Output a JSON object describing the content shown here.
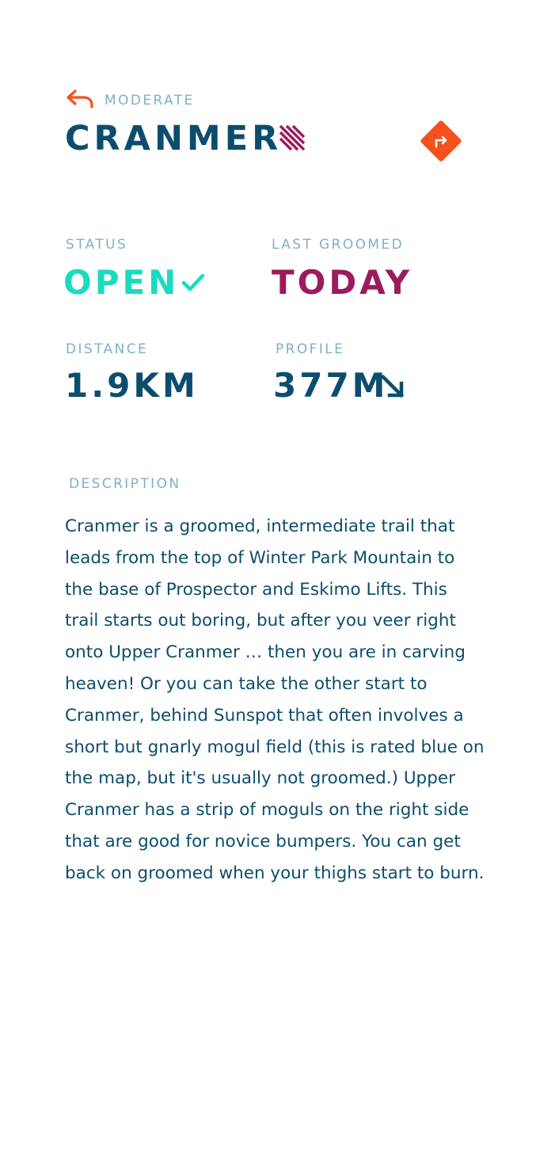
{
  "header": {
    "back_icon": "curved-back-arrow-icon",
    "difficulty": "MODERATE",
    "title": "CRANMER",
    "difficulty_icon": "diagonal-stripes-icon",
    "directions_icon": "turn-right-diamond-icon"
  },
  "stats": {
    "status": {
      "label": "STATUS",
      "value": "OPEN",
      "icon": "checkmark-icon"
    },
    "last_groomed": {
      "label": "LAST GROOMED",
      "value": "TODAY"
    },
    "distance": {
      "label": "DISTANCE",
      "value": "1.9KM"
    },
    "profile": {
      "label": "PROFILE",
      "value": "377M",
      "icon": "arrow-down-right-icon"
    }
  },
  "description": {
    "label": "DESCRIPTION",
    "text": "Cranmer is a groomed, intermediate trail that leads from the top of Winter Park Mountain to the base of Prospector and Eskimo Lifts. This trail starts out boring, but after you veer right onto Upper Cranmer … then you are in carving heaven! Or you can take the other start to Cranmer, behind Sunspot that often involves a short but gnarly mogul field (this is rated blue on the map, but it's usually not groomed.) Upper Cranmer has a strip of moguls on the right side that are good for novice bumpers. You can get back on groomed when your thighs start to burn."
  },
  "colors": {
    "accent_orange": "#f4511e",
    "title_navy": "#0c4d6e",
    "label_blue": "#7fb0c8",
    "open_teal": "#18dbc0",
    "groomed_magenta": "#9b1b5c"
  }
}
